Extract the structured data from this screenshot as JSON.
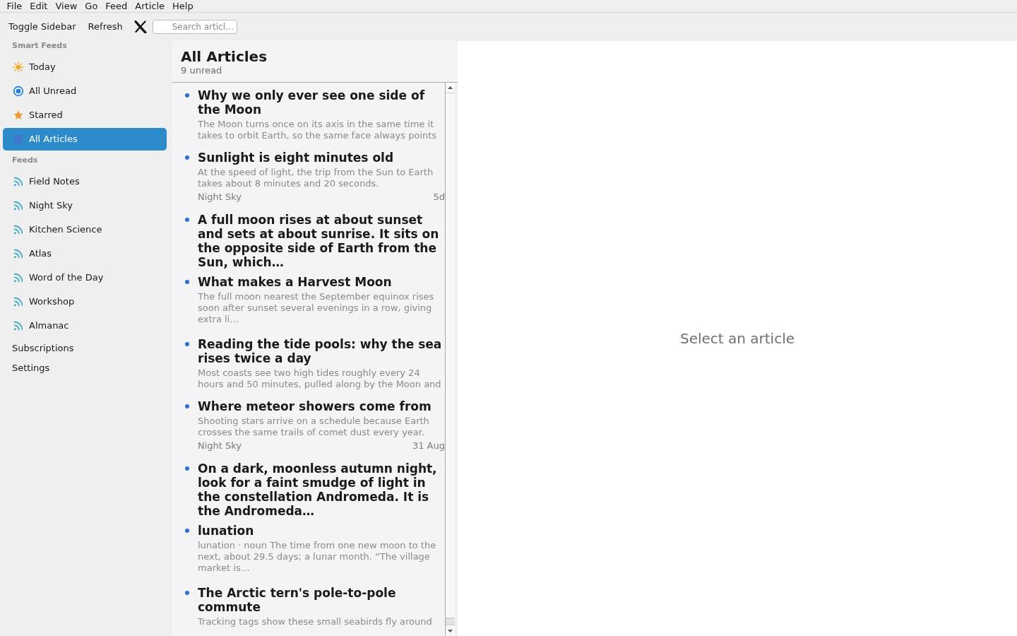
{
  "menu_bar": {
    "items": [
      "File",
      "Edit",
      "View",
      "Go",
      "Feed",
      "Article",
      "Help"
    ]
  },
  "toolbar": {
    "buttons": [
      "Toggle Sidebar",
      "Refresh"
    ],
    "search": {
      "placeholder": "Search articl…"
    }
  },
  "sidebar": {
    "sections": [
      {
        "heading": "Smart Feeds",
        "items": [
          {
            "label": "Today",
            "kind": "today",
            "selected": false
          },
          {
            "label": "All Unread",
            "kind": "unread",
            "selected": false
          },
          {
            "label": "Starred",
            "kind": "starred",
            "selected": false
          },
          {
            "label": "All Articles",
            "kind": "all",
            "selected": true
          }
        ]
      },
      {
        "heading": "Feeds",
        "items": [
          {
            "label": "Field Notes",
            "kind": "feed",
            "selected": false
          },
          {
            "label": "Night Sky",
            "kind": "feed",
            "selected": false
          },
          {
            "label": "Kitchen Science",
            "kind": "feed",
            "selected": false
          },
          {
            "label": "Atlas",
            "kind": "feed",
            "selected": false
          },
          {
            "label": "Word of the Day",
            "kind": "feed",
            "selected": false
          },
          {
            "label": "Workshop",
            "kind": "feed",
            "selected": false
          },
          {
            "label": "Almanac",
            "kind": "feed",
            "selected": false
          }
        ]
      }
    ],
    "links": [
      "Subscriptions",
      "Settings"
    ]
  },
  "article_list": {
    "title": "All Articles",
    "unread_count": "9 unread",
    "articles": [
      {
        "title": "Why we only ever see one side of the Moon",
        "summary": "The Moon turns once on its axis in the same time it takes to orbit Earth, so the same face always points",
        "unread": true
      },
      {
        "title": "Sunlight is eight minutes old",
        "summary": "At the speed of light, the trip from the Sun to Earth takes about 8 minutes and 20 seconds.",
        "feed": "Night Sky",
        "date": "5d",
        "unread": true
      },
      {
        "title": "A full moon rises at about sunset and sets at about sunrise. It sits on the opposite side of Earth from the Sun, which…",
        "unread": true
      },
      {
        "title": "What makes a Harvest Moon",
        "summary": "The full moon nearest the September equinox rises soon after sunset several evenings in a row, giving extra li…",
        "unread": true
      },
      {
        "title": "Reading the tide pools: why the sea rises twice a day",
        "summary": "Most coasts see two high tides roughly every 24 hours and 50 minutes, pulled along by the Moon and",
        "unread": true
      },
      {
        "title": "Where meteor showers come from",
        "summary": "Shooting stars arrive on a schedule because Earth crosses the same trails of comet dust every year.",
        "feed": "Night Sky",
        "date": "31 Aug",
        "unread": true
      },
      {
        "title": "On a dark, moonless autumn night, look for a faint smudge of light in the constellation Andromeda. It is the Andromeda…",
        "unread": true
      },
      {
        "title": "lunation",
        "summary": "lunation · noun The time from one new moon to the next, about 29.5 days; a lunar month. “The village market is…",
        "unread": true
      },
      {
        "title": "The Arctic tern's pole-to-pole commute",
        "summary": "Tracking tags show these small seabirds fly around",
        "unread": true
      }
    ]
  },
  "reader": {
    "placeholder": "Select an article"
  }
}
